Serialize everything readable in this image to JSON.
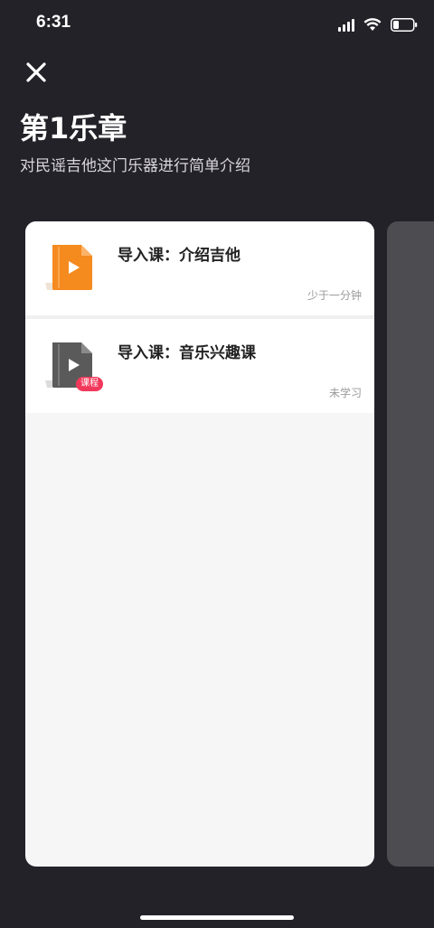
{
  "status_bar": {
    "time": "6:31",
    "icons": [
      "signal-icon",
      "wifi-icon",
      "battery-icon"
    ]
  },
  "header": {
    "close_icon": "close-icon",
    "title": "第1乐章",
    "subtitle": "对民谣吉他这门乐器进行简单介绍"
  },
  "lessons": [
    {
      "title": "导入课：介绍吉他",
      "status": "少于一分钟",
      "icon": "video-file-icon",
      "icon_color": "#f58a1f",
      "badge": ""
    },
    {
      "title": "导入课：音乐兴趣课",
      "status": "未学习",
      "icon": "video-file-icon",
      "icon_color": "#5a5a5a",
      "badge": "课程"
    }
  ],
  "colors": {
    "background": "#242229",
    "card": "#ffffff",
    "badge": "#f2385a"
  }
}
